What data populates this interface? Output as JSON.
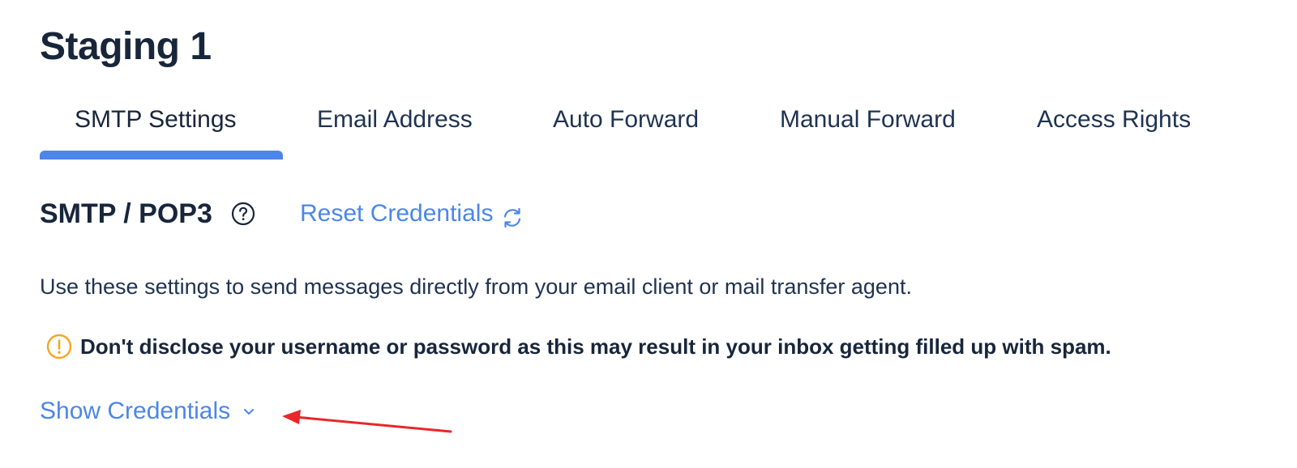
{
  "page": {
    "title": "Staging 1"
  },
  "tabs": [
    {
      "label": "SMTP Settings",
      "active": true
    },
    {
      "label": "Email Address",
      "active": false
    },
    {
      "label": "Auto Forward",
      "active": false
    },
    {
      "label": "Manual Forward",
      "active": false
    },
    {
      "label": "Access Rights",
      "active": false
    }
  ],
  "section": {
    "title": "SMTP / POP3",
    "help_icon": "question-circle-icon",
    "reset_label": "Reset Credentials",
    "reset_icon": "refresh-icon",
    "description": "Use these settings to send messages directly from your email client or mail transfer agent.",
    "warning_icon": "exclamation-circle-icon",
    "warning": "Don't disclose your username or password as this may result in your inbox getting filled up with spam.",
    "show_credentials_label": "Show Credentials",
    "show_credentials_icon": "chevron-down-icon"
  },
  "colors": {
    "accent": "#4c86ea",
    "text_dark": "#18263b",
    "warning": "#f5a623",
    "annotation_arrow": "#e8272a"
  }
}
